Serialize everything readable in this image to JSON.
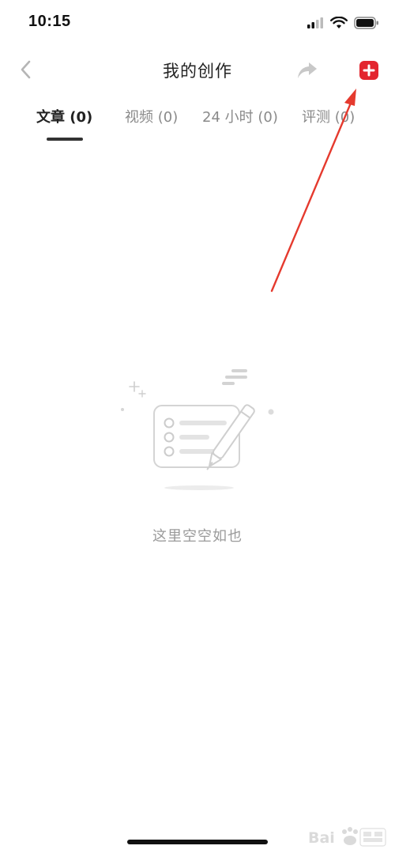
{
  "status_bar": {
    "time": "10:15",
    "icons": [
      "signal-icon",
      "wifi-icon",
      "battery-icon"
    ]
  },
  "nav": {
    "back_icon": "chevron-left-icon",
    "title": "我的创作",
    "share_icon": "share-arrow-icon",
    "add_icon": "plus-square-icon"
  },
  "tabs": [
    {
      "label": "文章 (0)",
      "active": true
    },
    {
      "label": "视频 (0)",
      "active": false
    },
    {
      "label": "24 小时 (0)",
      "active": false
    },
    {
      "label": "评测 (0)",
      "active": false
    }
  ],
  "empty_state": {
    "illustration": "empty-writing-illustration",
    "text": "这里空空如也"
  },
  "colors": {
    "accent_red": "#e3262f",
    "annotation_red": "#e53a2e",
    "title": "#222222",
    "inactive_tab": "#8a8a8a",
    "empty_text": "#9a9a9a",
    "icon_gray": "#c4c4c4"
  }
}
